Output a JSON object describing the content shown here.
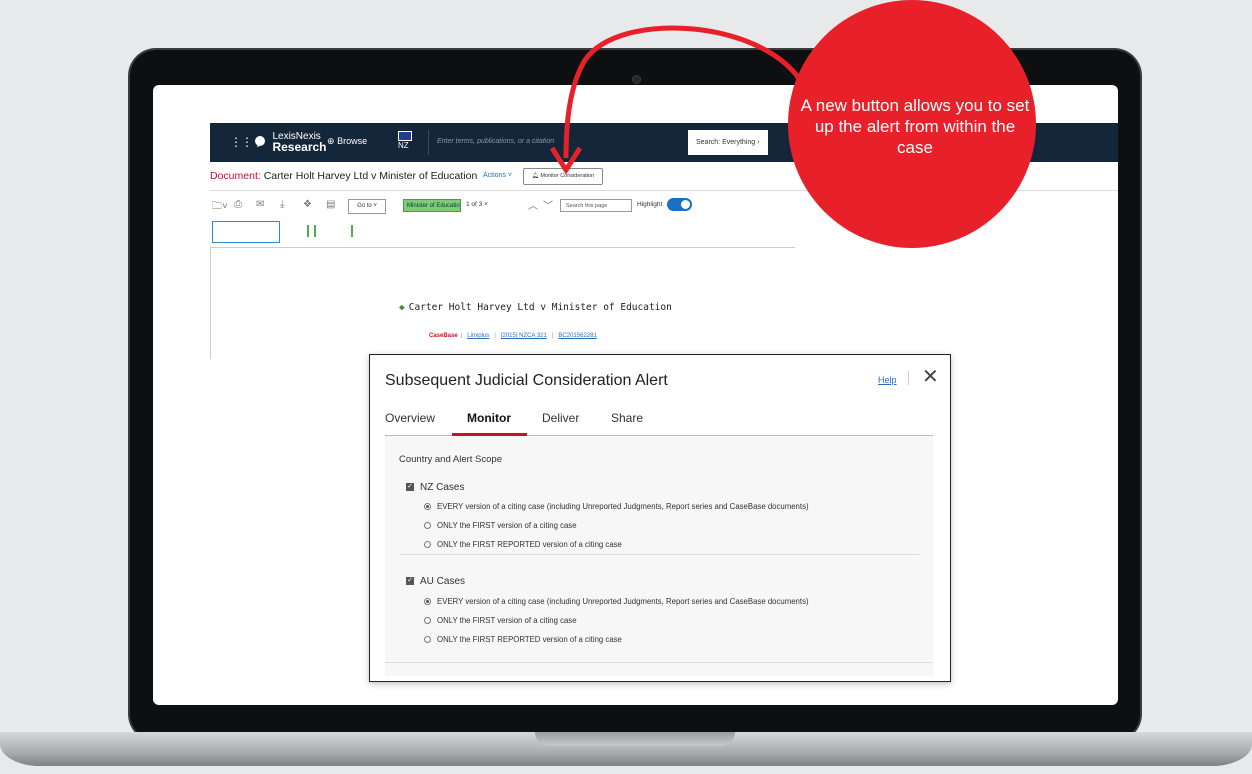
{
  "topbar": {
    "brand_top": "LexisNexis",
    "brand_bottom": "Research",
    "browse_label": "Browse",
    "country_code": "NZ",
    "search_placeholder": "Enter terms, publications, or a citation",
    "search_scope": "Search: Everything"
  },
  "docbar": {
    "doc_label": "Document:",
    "doc_title": "Carter Holt Harvey Ltd v Minister of Education",
    "actions_label": "Actions",
    "monitor_button": "Monitor Consideration"
  },
  "toolbar": {
    "goto_label": "Go to",
    "hit_term": "Minister of Educatio...",
    "hit_count": "1 of 3",
    "search_page_placeholder": "Search this page",
    "highlight_label": "Highlight",
    "highlight_on": true
  },
  "document": {
    "case_title": "Carter Holt Harvey Ltd v Minister of Education",
    "citations": {
      "casebase": "CaseBase",
      "linxplus": "Linxplus",
      "report": "[2015] NZCA 321",
      "bc": "BC201562281"
    }
  },
  "dialog": {
    "title": "Subsequent Judicial Consideration Alert",
    "help": "Help",
    "tabs": [
      "Overview",
      "Monitor",
      "Deliver",
      "Share"
    ],
    "active_tab": "Monitor",
    "scope_title": "Country and Alert Scope",
    "groups": [
      {
        "label": "NZ Cases",
        "checked": true,
        "options": [
          "EVERY version of a citing case (including Unreported Judgments, Report series and CaseBase documents)",
          "ONLY the FIRST version of a citing case",
          "ONLY the FIRST REPORTED version of a citing case"
        ],
        "selected": 0
      },
      {
        "label": "AU Cases",
        "checked": true,
        "options": [
          "EVERY version of a citing case (including Unreported Judgments, Report series and CaseBase documents)",
          "ONLY the FIRST version of a citing case",
          "ONLY the FIRST REPORTED version of a citing case"
        ],
        "selected": 0
      }
    ]
  },
  "callout": {
    "text": "A new button allows you to set up the alert from within the case",
    "color": "#e8202a"
  }
}
